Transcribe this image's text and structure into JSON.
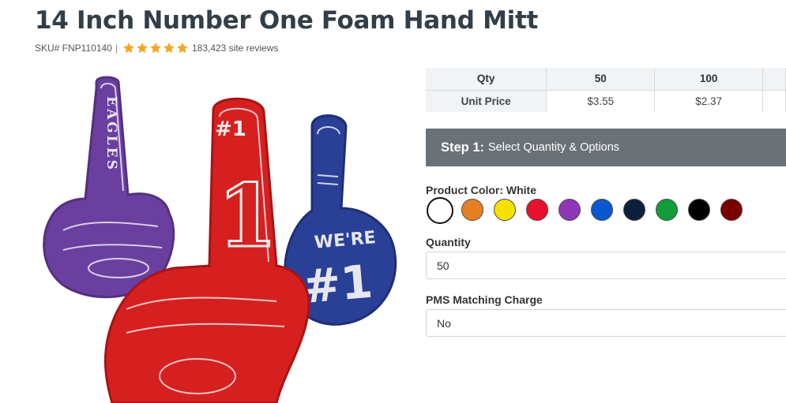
{
  "product": {
    "title": "14 Inch Number One Foam Hand Mitt",
    "sku": "SKU# FNP110140",
    "separator": "|",
    "rating_stars": 5,
    "reviews": "183,423 site reviews"
  },
  "image_text": {
    "purple_hand": "EAGLES",
    "red_hand": "#1",
    "blue_hand_line1": "WE'RE",
    "blue_hand_line2": "#1"
  },
  "price_table": {
    "row_qty_label": "Qty",
    "row_price_label": "Unit Price",
    "columns": [
      {
        "qty": "50",
        "price": "$3.55"
      },
      {
        "qty": "100",
        "price": "$2.37"
      }
    ]
  },
  "step": {
    "number": "Step 1:",
    "text": "Select Quantity & Options"
  },
  "color": {
    "label": "Product Color: White",
    "selected_index": 0,
    "swatches": [
      "#ffffff",
      "#e67e22",
      "#f5e000",
      "#e8102e",
      "#8e35b8",
      "#0b57d0",
      "#0d1f3c",
      "#129c3a",
      "#000000",
      "#7a0000"
    ]
  },
  "quantity": {
    "label": "Quantity",
    "value": "50"
  },
  "pms": {
    "label": "PMS Matching Charge",
    "value": "No"
  },
  "colors": {
    "title": "#333e48",
    "star": "#f5a623",
    "step_bg": "#6a7177",
    "table_header_bg": "#f1f4f7"
  }
}
